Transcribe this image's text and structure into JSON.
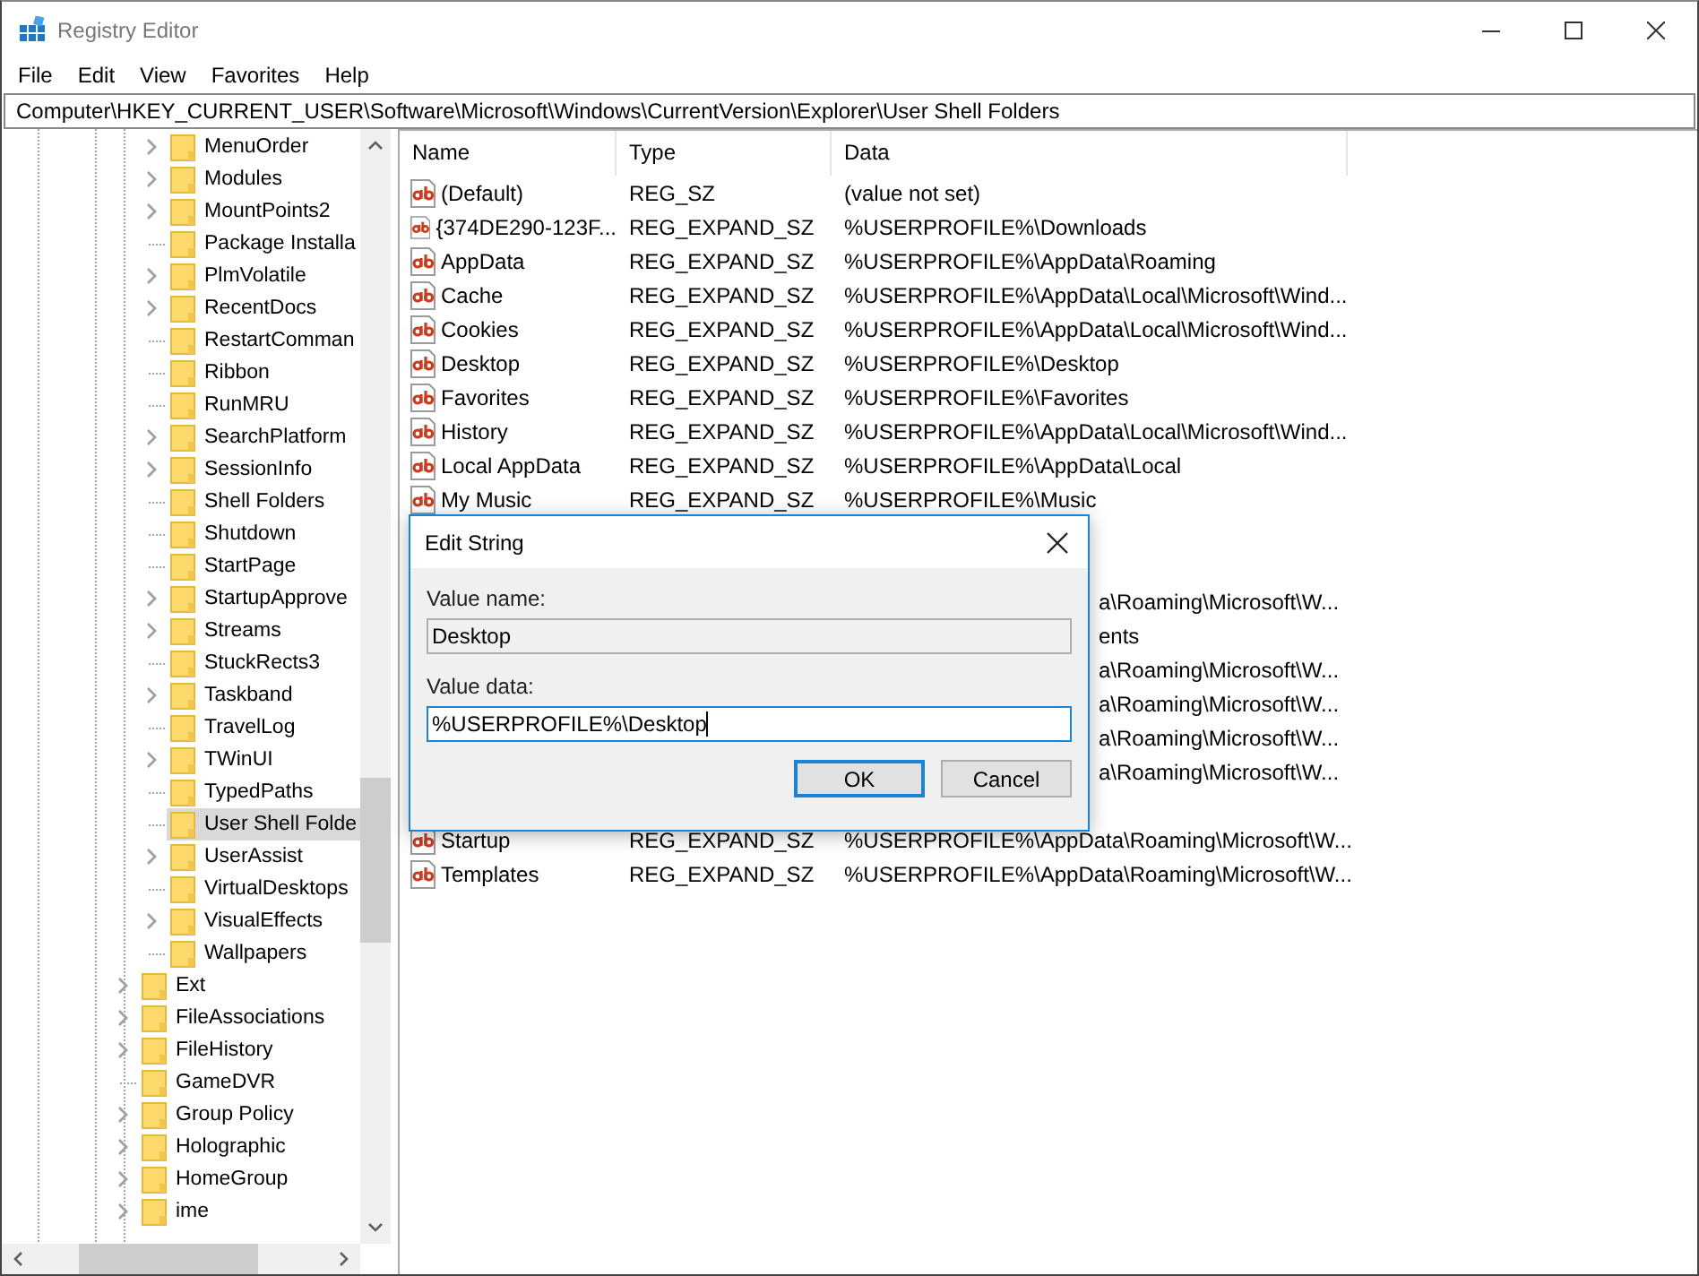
{
  "window": {
    "title": "Registry Editor"
  },
  "menu": [
    "File",
    "Edit",
    "View",
    "Favorites",
    "Help"
  ],
  "address": "Computer\\HKEY_CURRENT_USER\\Software\\Microsoft\\Windows\\CurrentVersion\\Explorer\\User Shell Folders",
  "tree": {
    "items": [
      {
        "children": [
          {
            "label": "MenuOrder",
            "has_children": true,
            "selected": false
          },
          {
            "label": "Modules",
            "has_children": true,
            "selected": false
          },
          {
            "label": "MountPoints2",
            "has_children": true,
            "selected": false
          },
          {
            "label": "Package Installa",
            "has_children": false,
            "selected": false
          },
          {
            "label": "PlmVolatile",
            "has_children": true,
            "selected": false
          },
          {
            "label": "RecentDocs",
            "has_children": true,
            "selected": false
          },
          {
            "label": "RestartComman",
            "has_children": false,
            "selected": false
          },
          {
            "label": "Ribbon",
            "has_children": false,
            "selected": false
          },
          {
            "label": "RunMRU",
            "has_children": false,
            "selected": false
          },
          {
            "label": "SearchPlatform",
            "has_children": true,
            "selected": false
          },
          {
            "label": "SessionInfo",
            "has_children": true,
            "selected": false
          },
          {
            "label": "Shell Folders",
            "has_children": false,
            "selected": false
          },
          {
            "label": "Shutdown",
            "has_children": false,
            "selected": false
          },
          {
            "label": "StartPage",
            "has_children": false,
            "selected": false
          },
          {
            "label": "StartupApprove",
            "has_children": true,
            "selected": false
          },
          {
            "label": "Streams",
            "has_children": true,
            "selected": false
          },
          {
            "label": "StuckRects3",
            "has_children": false,
            "selected": false
          },
          {
            "label": "Taskband",
            "has_children": true,
            "selected": false
          },
          {
            "label": "TravelLog",
            "has_children": false,
            "selected": false
          },
          {
            "label": "TWinUI",
            "has_children": true,
            "selected": false
          },
          {
            "label": "TypedPaths",
            "has_children": false,
            "selected": false
          },
          {
            "label": "User Shell Folde",
            "has_children": false,
            "selected": true
          },
          {
            "label": "UserAssist",
            "has_children": true,
            "selected": false
          },
          {
            "label": "VirtualDesktops",
            "has_children": false,
            "selected": false
          },
          {
            "label": "VisualEffects",
            "has_children": true,
            "selected": false
          },
          {
            "label": "Wallpapers",
            "has_children": false,
            "selected": false
          }
        ]
      },
      {
        "label": "Ext",
        "has_children": true,
        "selected": false
      },
      {
        "label": "FileAssociations",
        "has_children": true,
        "selected": false
      },
      {
        "label": "FileHistory",
        "has_children": true,
        "selected": false
      },
      {
        "label": "GameDVR",
        "has_children": false,
        "selected": false
      },
      {
        "label": "Group Policy",
        "has_children": true,
        "selected": false
      },
      {
        "label": "Holographic",
        "has_children": true,
        "selected": false
      },
      {
        "label": "HomeGroup",
        "has_children": true,
        "selected": false
      },
      {
        "label": "ime",
        "has_children": true,
        "selected": false
      }
    ]
  },
  "list": {
    "columns": [
      "Name",
      "Type",
      "Data"
    ],
    "rows": [
      {
        "name": "(Default)",
        "type": "REG_SZ",
        "data": "(value not set)"
      },
      {
        "name": "{374DE290-123F...",
        "type": "REG_EXPAND_SZ",
        "data": "%USERPROFILE%\\Downloads"
      },
      {
        "name": "AppData",
        "type": "REG_EXPAND_SZ",
        "data": "%USERPROFILE%\\AppData\\Roaming"
      },
      {
        "name": "Cache",
        "type": "REG_EXPAND_SZ",
        "data": "%USERPROFILE%\\AppData\\Local\\Microsoft\\Wind..."
      },
      {
        "name": "Cookies",
        "type": "REG_EXPAND_SZ",
        "data": "%USERPROFILE%\\AppData\\Local\\Microsoft\\Wind..."
      },
      {
        "name": "Desktop",
        "type": "REG_EXPAND_SZ",
        "data": "%USERPROFILE%\\Desktop"
      },
      {
        "name": "Favorites",
        "type": "REG_EXPAND_SZ",
        "data": "%USERPROFILE%\\Favorites"
      },
      {
        "name": "History",
        "type": "REG_EXPAND_SZ",
        "data": "%USERPROFILE%\\AppData\\Local\\Microsoft\\Wind..."
      },
      {
        "name": "Local AppData",
        "type": "REG_EXPAND_SZ",
        "data": "%USERPROFILE%\\AppData\\Local"
      },
      {
        "name": "My Music",
        "type": "REG_EXPAND_SZ",
        "data": "%USERPROFILE%\\Music"
      },
      {
        "covered": true
      },
      {
        "covered": true
      },
      {
        "covered": true,
        "data_tail": "a\\Roaming\\Microsoft\\W..."
      },
      {
        "covered": true,
        "data_tail": "ents"
      },
      {
        "covered": true,
        "data_tail": "a\\Roaming\\Microsoft\\W..."
      },
      {
        "covered": true,
        "data_tail": "a\\Roaming\\Microsoft\\W..."
      },
      {
        "covered": true,
        "data_tail": "a\\Roaming\\Microsoft\\W..."
      },
      {
        "covered": true,
        "data_tail": "a\\Roaming\\Microsoft\\W..."
      },
      {
        "covered": true
      },
      {
        "name": "Startup",
        "type": "REG_EXPAND_SZ",
        "data": "%USERPROFILE%\\AppData\\Roaming\\Microsoft\\W..."
      },
      {
        "name": "Templates",
        "type": "REG_EXPAND_SZ",
        "data": "%USERPROFILE%\\AppData\\Roaming\\Microsoft\\W..."
      }
    ]
  },
  "dialog": {
    "title": "Edit String",
    "value_name_label": "Value name:",
    "value_name": "Desktop",
    "value_data_label": "Value data:",
    "value_data": "%USERPROFILE%\\Desktop",
    "buttons": [
      {
        "label": "OK",
        "default": true
      },
      {
        "label": "Cancel",
        "default": false
      }
    ]
  }
}
